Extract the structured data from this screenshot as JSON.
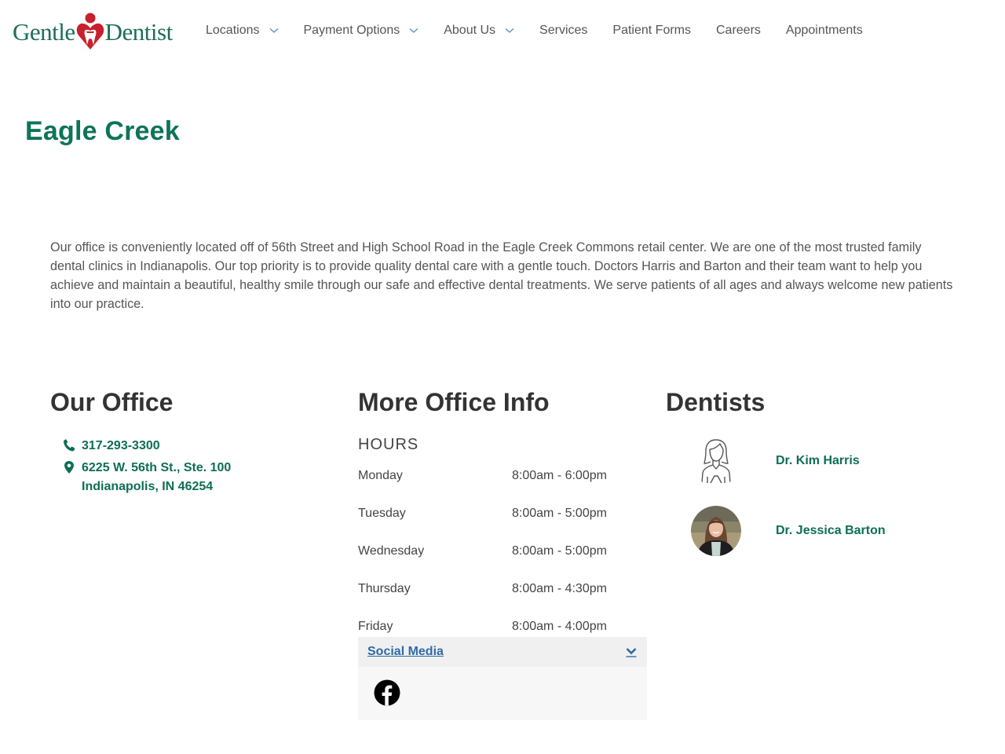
{
  "brand": {
    "logo_left": "Gentle",
    "logo_right": "Dentist",
    "primary_color": "#0e7458",
    "logo_heart_color": "#c8202d",
    "link_blue": "#2f6aa8"
  },
  "nav": {
    "items": [
      {
        "label": "Locations",
        "has_dropdown": true
      },
      {
        "label": "Payment Options",
        "has_dropdown": true
      },
      {
        "label": "About Us",
        "has_dropdown": true
      },
      {
        "label": "Services",
        "has_dropdown": false
      },
      {
        "label": "Patient Forms",
        "has_dropdown": false
      },
      {
        "label": "Careers",
        "has_dropdown": false
      },
      {
        "label": "Appointments",
        "has_dropdown": false
      }
    ]
  },
  "page": {
    "title": "Eagle Creek",
    "intro": "Our office is conveniently located off of 56th Street and High School Road in the Eagle Creek Commons retail center. We are one of the most trusted family dental clinics in Indianapolis. Our top priority is to provide quality dental care with a gentle touch. Doctors Harris and Barton and their team want to help you achieve and maintain a beautiful, healthy smile through our safe and effective dental treatments. We serve patients of all ages and always welcome new patients into our practice."
  },
  "office": {
    "heading": "Our Office",
    "phone": "317-293-3300",
    "address_line1": "6225 W. 56th St., Ste. 100",
    "address_line2": "Indianapolis, IN 46254",
    "phone_icon": "phone-icon",
    "address_icon": "map-pin-icon"
  },
  "more_info": {
    "heading": "More Office Info",
    "hours_label": "HOURS",
    "hours": [
      {
        "day": "Monday",
        "time": "8:00am - 6:00pm"
      },
      {
        "day": "Tuesday",
        "time": "8:00am - 5:00pm"
      },
      {
        "day": "Wednesday",
        "time": "8:00am - 5:00pm"
      },
      {
        "day": "Thursday",
        "time": "8:00am - 4:30pm"
      },
      {
        "day": "Friday",
        "time": "8:00am - 4:00pm"
      }
    ],
    "social": {
      "label": "Social Media",
      "toggle_icon": "chevron-down-icon",
      "links": [
        {
          "icon": "facebook-icon"
        }
      ]
    }
  },
  "dentists": {
    "heading": "Dentists",
    "items": [
      {
        "name": "Dr. Kim Harris",
        "avatar": "female-outline-placeholder"
      },
      {
        "name": "Dr. Jessica Barton",
        "avatar": "photo"
      }
    ]
  }
}
